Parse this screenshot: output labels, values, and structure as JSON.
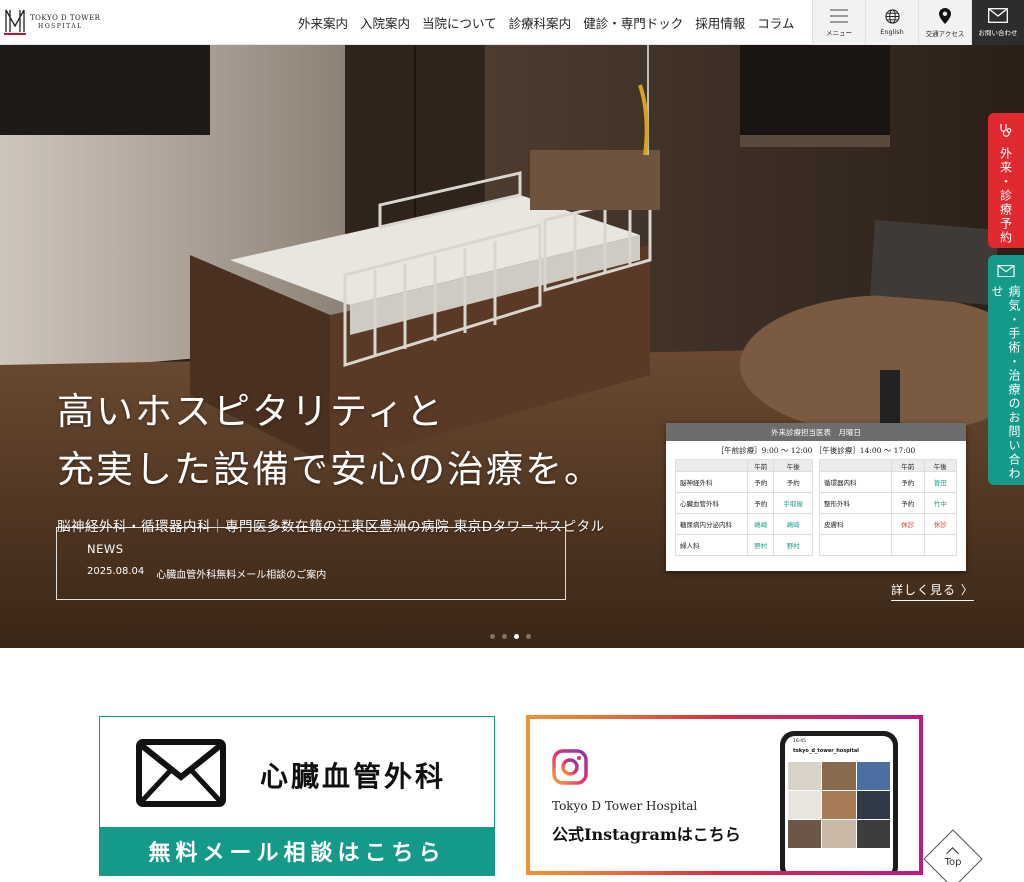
{
  "header": {
    "logo": {
      "line1": "TOKYO D TOWER",
      "line2": "HOSPITAL"
    },
    "nav": [
      {
        "label": "外来案内"
      },
      {
        "label": "入院案内"
      },
      {
        "label": "当院について"
      },
      {
        "label": "診療科案内"
      },
      {
        "label": "健診・専門ドック"
      },
      {
        "label": "採用情報"
      },
      {
        "label": "コラム"
      }
    ],
    "utility": [
      {
        "label": "メニュー",
        "icon": "hamburger-icon"
      },
      {
        "label": "English",
        "icon": "globe-icon"
      },
      {
        "label": "交通アクセス",
        "icon": "map-pin-icon"
      },
      {
        "label": "お問い合わせ",
        "icon": "mail-icon"
      }
    ]
  },
  "hero": {
    "title_line1": "高いホスピタリティと",
    "title_line2": "充実した設備で安心の治療を。",
    "subtitle": "脳神経外科・循環器内科｜専門医多数在籍の江東区豊洲の病院 東京Dタワーホスピタル",
    "news": {
      "heading": "NEWS",
      "date": "2025.08.04",
      "text": "心臓血管外科無料メール相談のご案内"
    },
    "schedule": {
      "title": "外来診療担当医表　月曜日",
      "hours": "［午前診療］9:00 〜 12:00 ［午後診療］14:00 〜 17:00",
      "col_am": "午前",
      "col_pm": "午後",
      "left_rows": [
        {
          "dept": "脳神経外科",
          "am": "予約",
          "pm": "予約",
          "am_color": "",
          "pm_color": ""
        },
        {
          "dept": "心臓血管外科",
          "am": "予約",
          "pm": "手取屋",
          "am_color": "",
          "pm_color": "g"
        },
        {
          "dept": "糖尿病内分泌内科",
          "am": "嶋崎",
          "pm": "嶋崎",
          "am_color": "g",
          "pm_color": "g"
        },
        {
          "dept": "婦人科",
          "am": "野村",
          "pm": "野村",
          "am_color": "g",
          "pm_color": "g"
        }
      ],
      "right_rows": [
        {
          "dept": "循環器内科",
          "am": "予約",
          "pm": "曽田",
          "am_color": "",
          "pm_color": "g"
        },
        {
          "dept": "整形外科",
          "am": "予約",
          "pm": "竹中",
          "am_color": "",
          "pm_color": "g"
        },
        {
          "dept": "皮膚科",
          "am": "休診",
          "pm": "休診",
          "am_color": "r",
          "pm_color": "r"
        },
        {
          "dept": "",
          "am": "",
          "pm": "",
          "am_color": "",
          "pm_color": ""
        }
      ]
    },
    "more_link": "詳しく見る 〉",
    "slide_count": 4,
    "active_slide": 3
  },
  "side_tabs": {
    "reserve": "外来・診療予約",
    "inquiry": "病気・手術・治療のお問い合わせ"
  },
  "banners": {
    "mail": {
      "title": "心臓血管外科",
      "cta": "無料メール相談はこちら"
    },
    "instagram": {
      "name": "Tokyo D Tower Hospital",
      "cta": "公式Instagramはこちら",
      "phone_time": "16:45",
      "phone_user": "tokyo_d_tower_hospital"
    }
  },
  "top_button": "Top",
  "colors": {
    "teal": "#159a8a",
    "red": "#e02a2f",
    "dark": "#2d2d2d"
  }
}
